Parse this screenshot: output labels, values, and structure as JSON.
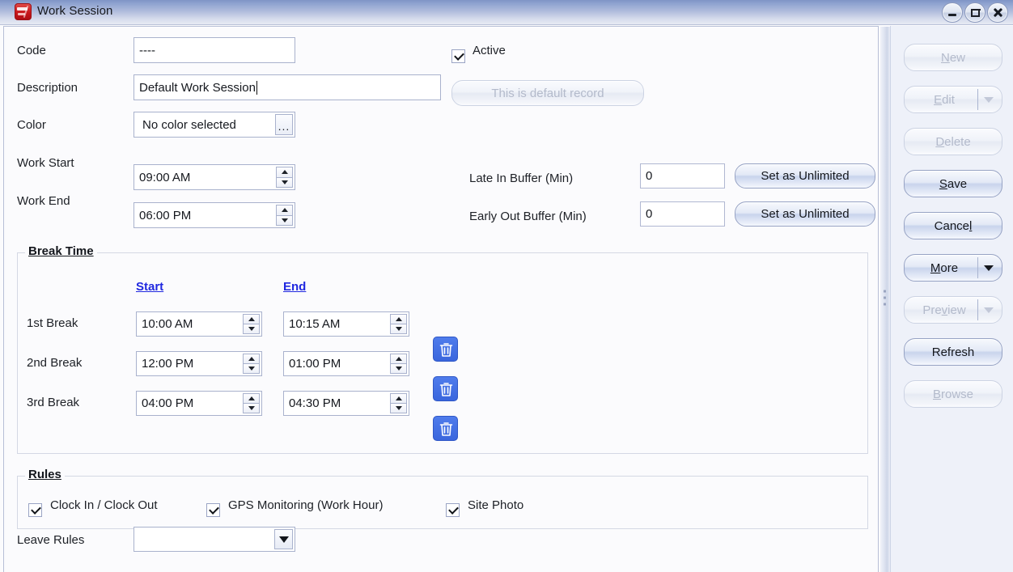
{
  "window": {
    "title": "Work Session",
    "icon": "app-icon",
    "controls": {
      "minimize": "minimize-icon",
      "maximize": "maximize-icon",
      "close": "close-icon"
    }
  },
  "form": {
    "code": {
      "label": "Code",
      "value": "----"
    },
    "description": {
      "label": "Description",
      "value": "Default Work Session",
      "focused": true
    },
    "color": {
      "label": "Color",
      "value": "No color selected",
      "browse_label": "..."
    },
    "work_start": {
      "label": "Work Start",
      "value": "09:00 AM"
    },
    "work_end": {
      "label": "Work End",
      "value": "06:00 PM"
    },
    "active": {
      "label": "Active",
      "checked": true
    },
    "default_record_button": {
      "label": "This is default record",
      "enabled": false
    },
    "late_in_buffer": {
      "label": "Late In Buffer (Min)",
      "value": "0",
      "action_label": "Set as Unlimited"
    },
    "early_out_buffer": {
      "label": "Early Out Buffer (Min)",
      "value": "0",
      "action_label": "Set as Unlimited"
    },
    "leave_rules": {
      "label": "Leave Rules",
      "value": ""
    }
  },
  "break_time": {
    "title": "Break Time",
    "columns": {
      "start": "Start",
      "end": "End"
    },
    "rows": [
      {
        "label": "1st Break",
        "start": "10:00 AM",
        "end": "10:15 AM",
        "delete": "delete-icon"
      },
      {
        "label": "2nd Break",
        "start": "12:00 PM",
        "end": "01:00 PM",
        "delete": "delete-icon"
      },
      {
        "label": "3rd Break",
        "start": "04:00 PM",
        "end": "04:30 PM",
        "delete": "delete-icon"
      }
    ]
  },
  "rules": {
    "title": "Rules",
    "items": [
      {
        "label": "Clock In / Clock Out",
        "checked": true
      },
      {
        "label": "GPS Monitoring (Work Hour)",
        "checked": true
      },
      {
        "label": "Site Photo",
        "checked": true
      }
    ]
  },
  "sidebar": {
    "buttons": [
      {
        "label": "New",
        "mnemonic": "N",
        "enabled": false,
        "dropdown": false
      },
      {
        "label": "Edit",
        "mnemonic": "E",
        "enabled": false,
        "dropdown": true
      },
      {
        "label": "Delete",
        "mnemonic": "D",
        "enabled": false,
        "dropdown": false
      },
      {
        "label": "Save",
        "mnemonic": "S",
        "enabled": true,
        "dropdown": false,
        "highlighted": true
      },
      {
        "label": "Cancel",
        "mnemonic": "l",
        "enabled": true,
        "dropdown": false
      },
      {
        "label": "More",
        "mnemonic": "M",
        "enabled": true,
        "dropdown": true
      },
      {
        "label": "Preview",
        "mnemonic": "v",
        "enabled": false,
        "dropdown": true
      },
      {
        "label": "Refresh",
        "mnemonic": "",
        "enabled": true,
        "dropdown": false
      },
      {
        "label": "Browse",
        "mnemonic": "B",
        "enabled": false,
        "dropdown": false
      }
    ]
  },
  "colors": {
    "titlebar_top": "#7f94c6",
    "titlebar_bottom": "#e7eaf4",
    "sidebar_bg": "#eef1f9",
    "form_bg": "#fbfbfd",
    "highlight": "#ea3b27",
    "link": "#2028e0",
    "trash_button": "#3a66dd"
  }
}
